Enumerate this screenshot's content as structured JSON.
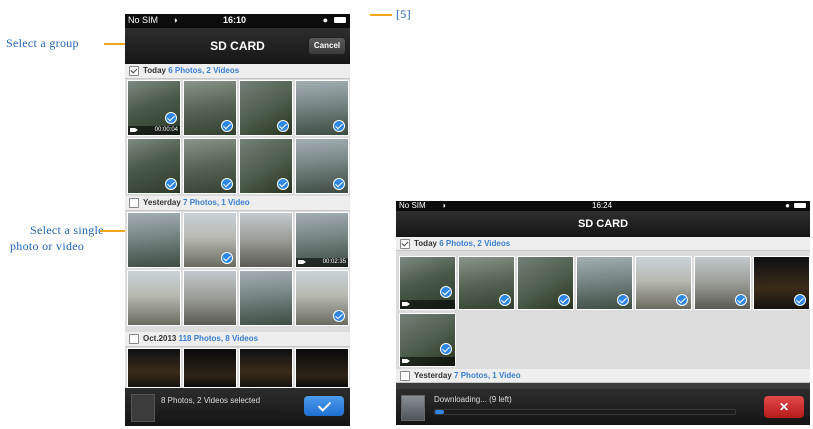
{
  "figure_tag": "[5]",
  "annotations": {
    "select_group": "Select a group",
    "select_single_line1": "Select a single",
    "select_single_line2": "photo or video"
  },
  "phone_left": {
    "status": {
      "carrier": "No SIM",
      "time": "16:10"
    },
    "nav": {
      "title": "SD CARD",
      "cancel_label": "Cancel"
    },
    "sections": [
      {
        "title": "Today",
        "count": "6 Photos, 2 Videos",
        "checked": true
      },
      {
        "title": "Yesterday",
        "count": "7 Photos, 1 Video",
        "checked": false
      },
      {
        "title": "Oct.2013",
        "count": "118 Photos, 8 Videos",
        "checked": false
      }
    ],
    "video_durations": [
      "00:00:04",
      "00:00:04",
      "00:02:35"
    ],
    "selection_text": "8 Photos, 2 Videos selected"
  },
  "phone_right": {
    "status": {
      "carrier": "No SIM",
      "time": "16:24"
    },
    "nav": {
      "title": "SD CARD"
    },
    "sections": [
      {
        "title": "Today",
        "count": "6 Photos, 2 Videos",
        "checked": true
      },
      {
        "title": "Yesterday",
        "count": "7 Photos, 1 Video",
        "checked": false
      }
    ],
    "downloading_text": "Downloading... (9 left)",
    "cancel_symbol": "✕",
    "download_progress": 0.03
  },
  "colors": {
    "accent_blue": "#2f86e6",
    "callout_orange": "#f2a81d",
    "cancel_red": "#c82020"
  }
}
